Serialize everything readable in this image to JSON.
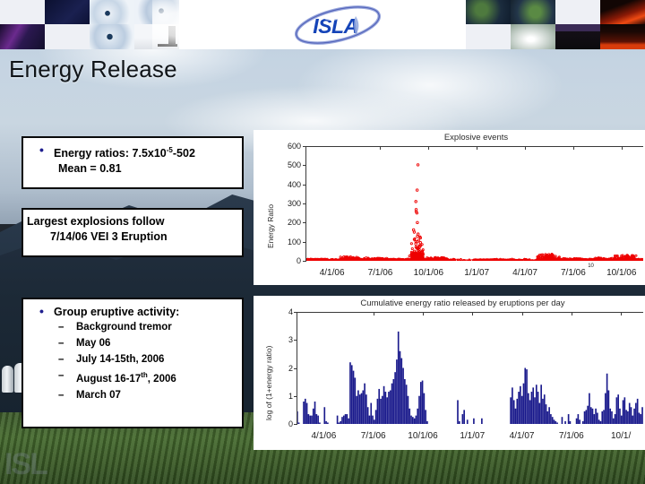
{
  "header": {
    "logo_text": "ISLA",
    "logo_alt": "isla-orbit-logo",
    "left_thumbs": [
      {
        "name": "thumb-blank-1",
        "color": "#eef0f5"
      },
      {
        "name": "thumb-night-sky-streak",
        "color": "#0e1334"
      },
      {
        "name": "thumb-wave-ice-1",
        "color": "#cfd8e3"
      },
      {
        "name": "thumb-wave-ice-2",
        "color": "#c6d2e0"
      },
      {
        "name": "thumb-aurora",
        "color": "#140c28"
      },
      {
        "name": "thumb-blank-2",
        "color": "#eef0f5"
      },
      {
        "name": "thumb-wave-ice-3",
        "color": "#c9d4e2"
      },
      {
        "name": "thumb-instrument",
        "color": "#f2f4f7"
      }
    ],
    "right_thumbs": [
      {
        "name": "thumb-earth-1",
        "color": "#2d4a33"
      },
      {
        "name": "thumb-earth-2",
        "color": "#34573a"
      },
      {
        "name": "thumb-blank-3",
        "color": "#eef0f5"
      },
      {
        "name": "thumb-lava-1",
        "color": "#3a0d06"
      },
      {
        "name": "thumb-blank-4",
        "color": "#eef0f5"
      },
      {
        "name": "thumb-cloud-satellite",
        "color": "#cfd5d0"
      },
      {
        "name": "thumb-volcano-night",
        "color": "#150f18"
      },
      {
        "name": "thumb-lava-2",
        "color": "#2a0b05"
      }
    ]
  },
  "title": "Energy Release",
  "watermark": "ISL",
  "content": {
    "ratios": {
      "bullet": "•",
      "line1_pre": "Energy ratios: 7.5x10",
      "line1_sup": "-5",
      "line1_post": "-502",
      "line2": "Mean = 0.81"
    },
    "largest": {
      "line1": "Largest explosions follow",
      "line2": "7/14/06 VEI 3 Eruption"
    },
    "group": {
      "bullet": "•",
      "heading": "Group eruptive activity:",
      "dash": "–",
      "items": [
        {
          "text": "Background tremor"
        },
        {
          "text": "May 06"
        },
        {
          "text": "July 14-15th, 2006"
        },
        {
          "text_pre": "August 16-17",
          "sup": "th",
          "text_post": ", 2006"
        },
        {
          "text": "March 07"
        }
      ]
    }
  },
  "chart_data": [
    {
      "id": "explosive-events",
      "type": "scatter",
      "title": "Explosive events",
      "xlabel": "",
      "ylabel": "Energy Ratio",
      "ylim": [
        0,
        600
      ],
      "yticks": [
        0,
        100,
        200,
        300,
        400,
        500,
        600
      ],
      "xticks": [
        "4/1/06",
        "7/1/06",
        "10/1/06",
        "1/1/07",
        "4/1/07",
        "7/1/06",
        "10/1/06"
      ],
      "x_superscript_artifact": "10",
      "marker": "open-circle",
      "color": "#ee0000",
      "grid": false,
      "notes": "Dense near-zero band across entire record; large vertical spike near 7/14/06 with outliers at 502, 370, 310, 265, 250, 200, 160, 140, 120, 95, 80, 70, 55, 40.",
      "peak_value": 502,
      "mean_value": 0.81,
      "min_value": 7.5e-05,
      "clusters": [
        {
          "x_frac": 0.02,
          "y_max": 8
        },
        {
          "x_frac": 0.14,
          "y_max": 22
        },
        {
          "x_frac": 0.22,
          "y_max": 14
        },
        {
          "x_frac": 0.33,
          "y_max": 502
        },
        {
          "x_frac": 0.4,
          "y_max": 18
        },
        {
          "x_frac": 0.53,
          "y_max": 6
        },
        {
          "x_frac": 0.6,
          "y_max": 5
        },
        {
          "x_frac": 0.72,
          "y_max": 35
        },
        {
          "x_frac": 0.8,
          "y_max": 12
        },
        {
          "x_frac": 0.88,
          "y_max": 16
        },
        {
          "x_frac": 0.95,
          "y_max": 30
        }
      ]
    },
    {
      "id": "cumulative-energy-per-day",
      "type": "bar",
      "title": "Cumulative energy ratio released by eruptions per day",
      "xlabel": "",
      "ylabel": "log of (1+energy ratio)",
      "ylim": [
        0,
        4
      ],
      "yticks": [
        0,
        1,
        2,
        3,
        4
      ],
      "xticks": [
        "4/1/06",
        "7/1/06",
        "10/1/06",
        "1/1/07",
        "4/1/07",
        "7/1/06",
        "10/1/"
      ],
      "color": "#1a1a8c",
      "grid": false,
      "peak_value": 3.3,
      "values": [
        0.45,
        0.05,
        0.0,
        0.0,
        0.8,
        0.9,
        0.75,
        0.35,
        0.3,
        0.3,
        0.55,
        0.8,
        0.35,
        0.3,
        0.05,
        0.0,
        0.0,
        0.6,
        0.1,
        0.05,
        0.0,
        0.0,
        0.0,
        0.0,
        0.0,
        0.3,
        0.05,
        0.1,
        0.25,
        0.3,
        0.35,
        0.35,
        0.2,
        2.2,
        2.1,
        1.9,
        1.65,
        1.0,
        1.2,
        1.05,
        1.1,
        1.2,
        1.45,
        1.05,
        0.6,
        0.3,
        0.75,
        0.3,
        0.15,
        0.5,
        0.9,
        1.25,
        0.9,
        1.0,
        1.35,
        1.15,
        0.95,
        1.15,
        1.2,
        1.45,
        1.6,
        1.85,
        2.3,
        3.3,
        2.6,
        2.35,
        2.0,
        1.6,
        1.4,
        1.0,
        0.55,
        0.3,
        0.25,
        0.2,
        0.3,
        0.55,
        1.0,
        1.5,
        1.55,
        1.1,
        0.5,
        0.1,
        0.0,
        0.0,
        0.0,
        0.0,
        0.0,
        0.0,
        0.0,
        0.0,
        0.0,
        0.0,
        0.0,
        0.0,
        0.0,
        0.0,
        0.0,
        0.0,
        0.0,
        0.0,
        0.85,
        0.1,
        0.0,
        0.35,
        0.5,
        0.0,
        0.15,
        0.0,
        0.0,
        0.0,
        0.2,
        0.0,
        0.0,
        0.0,
        0.0,
        0.2,
        0.0,
        0.0,
        0.0,
        0.0,
        0.0,
        0.0,
        0.0,
        0.0,
        0.0,
        0.0,
        0.0,
        0.0,
        0.0,
        0.0,
        0.0,
        0.0,
        0.0,
        0.95,
        1.3,
        0.85,
        0.55,
        0.9,
        1.15,
        1.35,
        1.0,
        1.45,
        2.0,
        1.95,
        1.1,
        0.85,
        1.15,
        1.3,
        0.95,
        1.4,
        1.15,
        0.75,
        1.4,
        0.9,
        1.05,
        0.7,
        0.45,
        0.6,
        0.35,
        0.25,
        0.15,
        0.1,
        0.05,
        0.0,
        0.0,
        0.25,
        0.0,
        0.1,
        0.0,
        0.35,
        0.1,
        0.0,
        0.0,
        0.0,
        0.2,
        0.35,
        0.15,
        0.0,
        0.1,
        0.45,
        0.5,
        0.65,
        1.1,
        0.6,
        0.55,
        0.35,
        0.55,
        0.4,
        0.15,
        0.1,
        0.45,
        0.5,
        1.1,
        1.8,
        1.2,
        0.55,
        0.45,
        0.2,
        0.35,
        0.95,
        1.05,
        0.55,
        0.3,
        0.85,
        0.95,
        0.5,
        0.45,
        0.75,
        0.6,
        0.3,
        0.55,
        0.75,
        0.9,
        0.4,
        0.35,
        0.6
      ]
    }
  ]
}
